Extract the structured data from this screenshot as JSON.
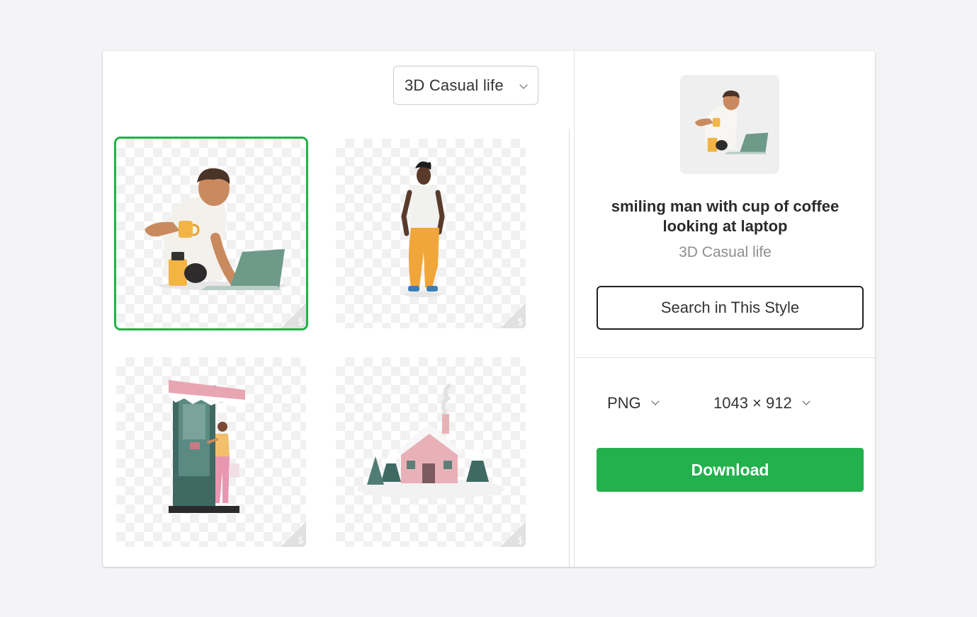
{
  "filter": {
    "style_label": "3D Casual life"
  },
  "grid": {
    "items": [
      {
        "name": "smiling man with cup of coffee looking at laptop",
        "selected": true,
        "premium_icon": "dollar-icon"
      },
      {
        "name": "standing man",
        "selected": false,
        "premium_icon": "dollar-icon"
      },
      {
        "name": "woman at shop door",
        "selected": false,
        "premium_icon": "dollar-icon"
      },
      {
        "name": "snowy house",
        "selected": false,
        "premium_icon": "dollar-icon"
      }
    ]
  },
  "details": {
    "title": "smiling man with cup of coffee looking at laptop",
    "style_name": "3D Casual life",
    "search_style_label": "Search in This Style",
    "format": "PNG",
    "size": "1043 × 912",
    "download_label": "Download"
  },
  "colors": {
    "accent": "#22b14c",
    "selected_border": "#1db445"
  }
}
